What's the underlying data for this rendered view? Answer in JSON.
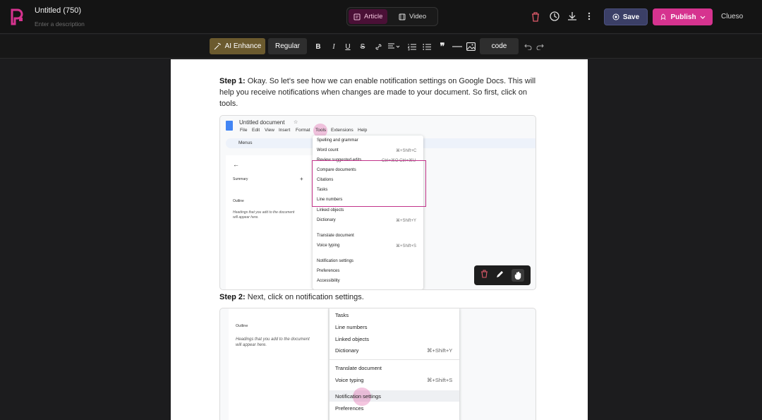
{
  "header": {
    "title": "Untitled (750)",
    "description_placeholder": "Enter a description",
    "tabs": [
      {
        "label": "Article"
      },
      {
        "label": "Video"
      }
    ],
    "save_label": "Save",
    "publish_label": "Publish",
    "brand": "Clueso"
  },
  "toolbar": {
    "ai_label": "AI Enhance",
    "style_label": "Regular",
    "code_label": "code"
  },
  "content": {
    "step1_label": "Step 1:",
    "step1_text": " Okay. So let's see how we can enable notification settings on Google Docs. This will help you receive notifications when changes are made to your document. So first, click on tools.",
    "step2_label": "Step 2:",
    "step2_text": " Next, click on notification settings."
  },
  "screenshot1": {
    "doc_title": "Untitled document",
    "menubar": [
      "File",
      "Edit",
      "View",
      "Insert",
      "Format",
      "Tools",
      "Extensions",
      "Help"
    ],
    "search": "Menus",
    "summary": "Summary",
    "outline": "Outline",
    "outline_hint_1": "Headings that you add to the document",
    "outline_hint_2": "will appear here.",
    "menu_items": [
      {
        "label": "Spelling and grammar",
        "shortcut": ""
      },
      {
        "label": "Word count",
        "shortcut": "⌘+Shift+C"
      },
      {
        "label": "Review suggested edits",
        "shortcut": "Ctrl+⌘O Ctrl+⌘U"
      },
      {
        "label": "Compare documents",
        "shortcut": ""
      },
      {
        "label": "Citations",
        "shortcut": ""
      },
      {
        "label": "Tasks",
        "shortcut": ""
      },
      {
        "label": "Line numbers",
        "shortcut": ""
      },
      {
        "label": "Linked objects",
        "shortcut": ""
      },
      {
        "label": "Dictionary",
        "shortcut": "⌘+Shift+Y"
      },
      {
        "label": "Translate document",
        "shortcut": ""
      },
      {
        "label": "Voice typing",
        "shortcut": "⌘+Shift+S"
      },
      {
        "label": "Notification settings",
        "shortcut": ""
      },
      {
        "label": "Preferences",
        "shortcut": ""
      },
      {
        "label": "Accessibility",
        "shortcut": ""
      }
    ]
  },
  "screenshot2": {
    "outline": "Outline",
    "outline_hint_1": "Headings that you add to the document",
    "outline_hint_2": "will appear here.",
    "menu_items": [
      {
        "label": "Tasks",
        "shortcut": ""
      },
      {
        "label": "Line numbers",
        "shortcut": ""
      },
      {
        "label": "Linked objects",
        "shortcut": ""
      },
      {
        "label": "Dictionary",
        "shortcut": "⌘+Shift+Y"
      },
      {
        "label": "Translate document",
        "shortcut": ""
      },
      {
        "label": "Voice typing",
        "shortcut": "⌘+Shift+S"
      },
      {
        "label": "Notification settings",
        "shortcut": ""
      },
      {
        "label": "Preferences",
        "shortcut": ""
      }
    ]
  },
  "colors": {
    "accent": "#d6338f",
    "ai_button": "#6b5a2e",
    "save_button": "#3b3f66",
    "highlight_box": "#c2338a"
  }
}
